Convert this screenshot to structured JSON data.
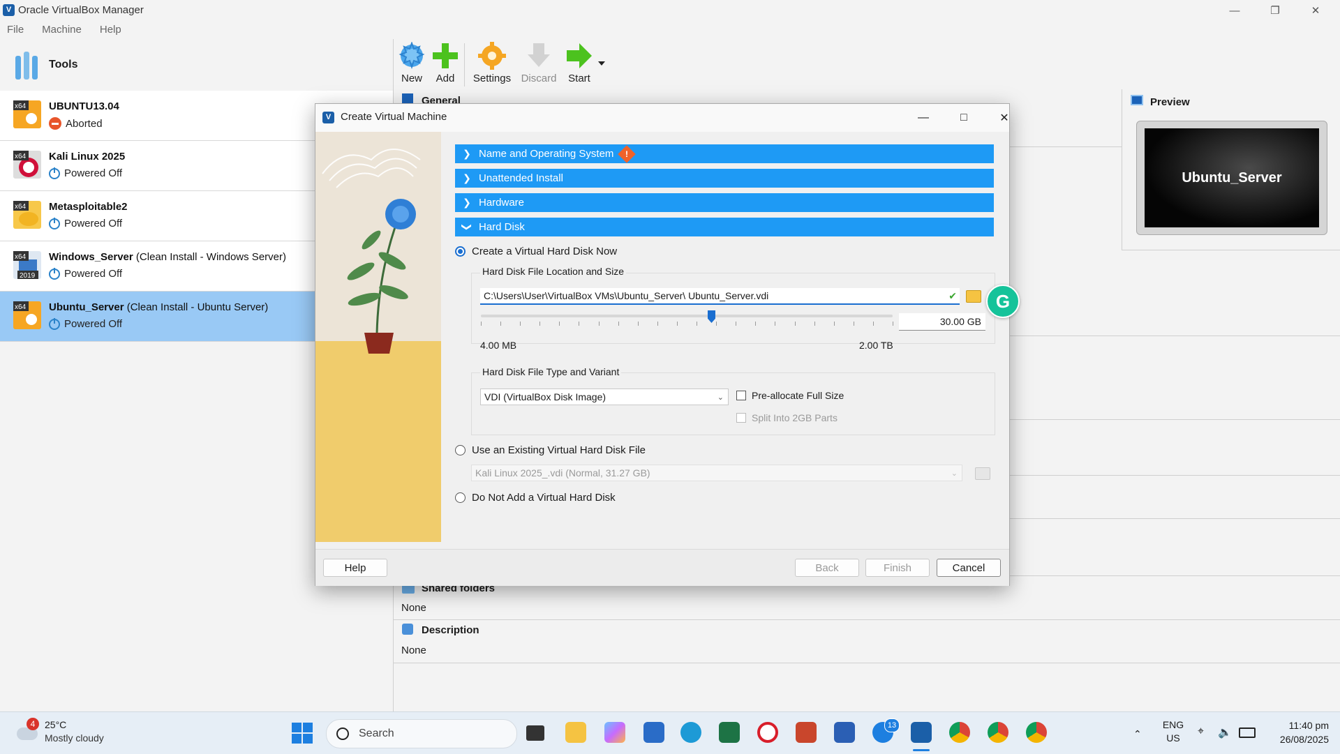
{
  "app": {
    "title": "Oracle VirtualBox Manager",
    "menu": [
      "File",
      "Machine",
      "Help"
    ],
    "tools_label": "Tools"
  },
  "toolbar": {
    "new": "New",
    "add": "Add",
    "settings": "Settings",
    "discard": "Discard",
    "start": "Start"
  },
  "vms": [
    {
      "name": "UBUNTU13.04",
      "note": "",
      "state": "Aborted",
      "badge": "x64"
    },
    {
      "name": "Kali Linux 2025",
      "note": "",
      "state": "Powered Off",
      "badge": "x64"
    },
    {
      "name": "Metasploitable2",
      "note": "",
      "state": "Powered Off",
      "badge": "x64"
    },
    {
      "name": "Windows_Server",
      "note": "(Clean Install - Windows Server)",
      "state": "Powered Off",
      "badge": "x64",
      "badge2": "2019"
    },
    {
      "name": "Ubuntu_Server",
      "note": "(Clean Install - Ubuntu Server)",
      "state": "Powered Off",
      "badge": "x64"
    }
  ],
  "details": {
    "general_label": "General",
    "preview_label": "Preview",
    "preview_text": "Ubuntu_Server",
    "shared_folders_label": "Shared folders",
    "shared_folders_value": "None",
    "description_label": "Description",
    "description_value": "None"
  },
  "dialog": {
    "title": "Create Virtual Machine",
    "sections": {
      "name_os": "Name and Operating System",
      "unattended": "Unattended Install",
      "hardware": "Hardware",
      "hard_disk": "Hard Disk"
    },
    "create_now": "Create a Virtual Hard Disk Now",
    "location_group": "Hard Disk File Location and Size",
    "file_path": "C:\\Users\\User\\VirtualBox VMs\\Ubuntu_Server\\ Ubuntu_Server.vdi",
    "size_value": "30.00 GB",
    "size_fraction": 0.56,
    "size_min": "4.00 MB",
    "size_max": "2.00 TB",
    "type_group": "Hard Disk File Type and Variant",
    "disk_type": "VDI (VirtualBox Disk Image)",
    "preallocate": "Pre-allocate Full Size",
    "split": "Split Into 2GB Parts",
    "use_existing": "Use an Existing Virtual Hard Disk File",
    "existing_value": "Kali Linux 2025_.vdi (Normal, 31.27 GB)",
    "no_disk": "Do Not Add a Virtual Hard Disk",
    "buttons": {
      "help": "Help",
      "back": "Back",
      "finish": "Finish",
      "cancel": "Cancel"
    }
  },
  "taskbar": {
    "weather_temp": "25°C",
    "weather_desc": "Mostly cloudy",
    "weather_badge": "4",
    "search_placeholder": "Search",
    "messenger_badge": "13",
    "lang_1": "ENG",
    "lang_2": "US",
    "time": "11:40 pm",
    "date": "26/08/2025"
  }
}
